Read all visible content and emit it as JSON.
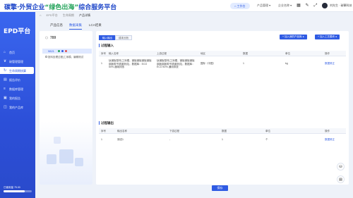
{
  "header": {
    "brand_prefix": "碳擎·外贸企业",
    "brand_accent": "“绿色出海”",
    "brand_suffix": "综合服务平台",
    "work_label": "工作台",
    "dropdown1": "产品管理",
    "dropdown2": "企业名称",
    "user_name": "刘先生 · 碳擎科技"
  },
  "sidebar": {
    "logo": "EPD平台",
    "items": [
      {
        "label": "首页",
        "icon": "home-icon"
      },
      {
        "label": "碳管理管理",
        "icon": "leaf-icon"
      },
      {
        "label": "生命周期核算",
        "icon": "cycle-icon"
      },
      {
        "label": "报告评价",
        "icon": "doc-icon"
      },
      {
        "label": "数据库管理",
        "icon": "db-icon"
      },
      {
        "label": "我的报告",
        "icon": "report-icon"
      },
      {
        "label": "我的产品库",
        "icon": "box-icon"
      }
    ],
    "progress_label": "已使用量 75.00",
    "progress_value": 0.75
  },
  "breadcrumb": [
    "EPD平台",
    "生命周期",
    "产品详情"
  ],
  "tabs": [
    "产品信息",
    "数据采集",
    "LCA结果"
  ],
  "tree": {
    "root_label": "789",
    "node_label": "9821",
    "child_label": "投料处理过程(工序模，编辑测试"
  },
  "main": {
    "subtabs": [
      "输入输出",
      "成本分析"
    ],
    "buttons": [
      "+ 加入我的产品库 ●",
      "+ 加入工艺模块 ●"
    ],
    "input_section": {
      "title": "过程输入",
      "headers": [
        "序号",
        "输入名称",
        "上游过程",
        "地区",
        "数据",
        "单位",
        "操作"
      ],
      "rows": [
        {
          "no": "1",
          "name": "钛钢板型材(工序模，钢板钢板钢板钢板钢板带不锈钢测试)，数据库：ECO 50%-通用排放",
          "upstream": "钛钢板型材(工序模，钢板钢板钢板钢板钢板带不锈钢测试)，数据库：ECO 50%-通用排放",
          "region": "国际（中国）",
          "data": "1",
          "unit": "kg",
          "op": "数据修正"
        }
      ]
    },
    "output_section": {
      "title": "过程输出",
      "headers": [
        "序号",
        "输出名称",
        "下游过程",
        "数据",
        "单位",
        "操作"
      ],
      "rows": [
        {
          "no": "1",
          "name": "测试1",
          "downstream": "-",
          "data": "1",
          "unit": "个",
          "op": "数据修正"
        }
      ]
    },
    "save_label": "保存"
  }
}
